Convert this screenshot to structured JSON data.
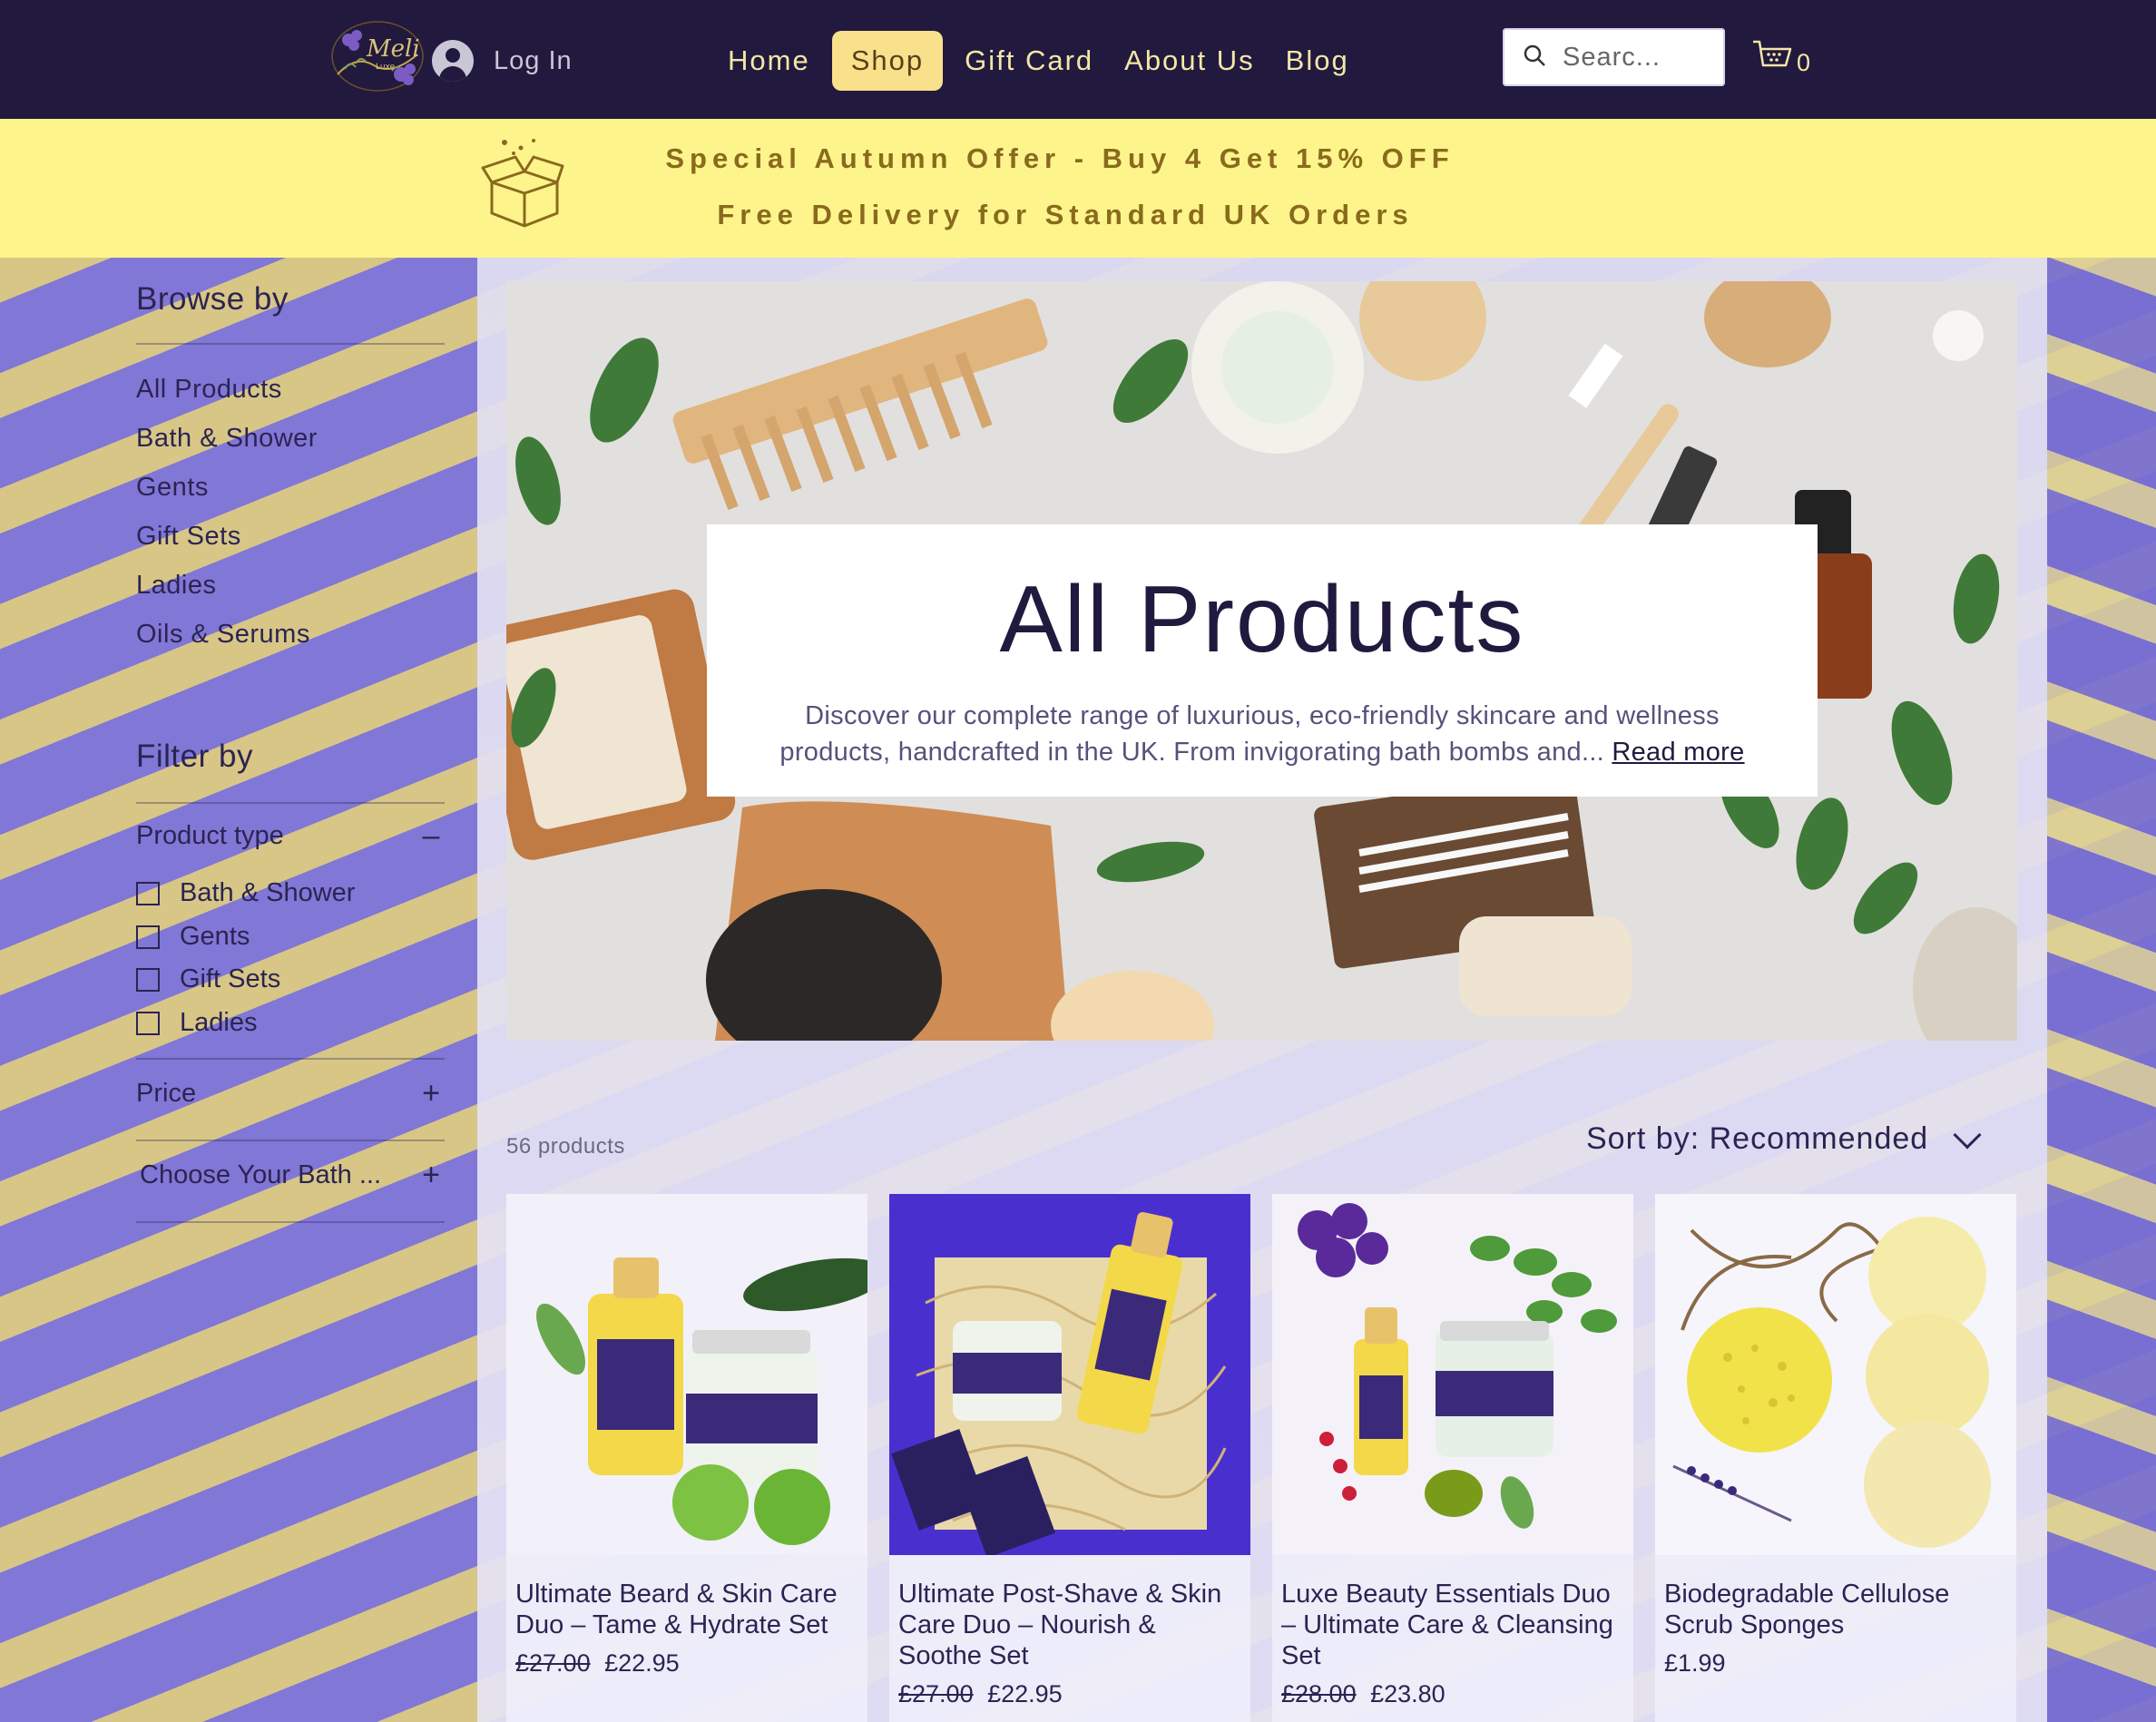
{
  "header": {
    "login_label": "Log In",
    "nav": [
      "Home",
      "Shop",
      "Gift Card",
      "About Us",
      "Blog"
    ],
    "active_nav": "Shop",
    "search_placeholder": "Searc...",
    "cart_count": "0"
  },
  "promo": {
    "line1": "Special Autumn Offer - Buy 4 Get 15% OFF",
    "line2": "Free Delivery for Standard UK Orders"
  },
  "sidebar": {
    "browse_heading": "Browse by",
    "browse_items": [
      "All Products",
      "Bath & Shower",
      "Gents",
      "Gift Sets",
      "Ladies",
      "Oils & Serums"
    ],
    "filter_heading": "Filter by",
    "product_type_label": "Product type",
    "product_type_options": [
      "Bath & Shower",
      "Gents",
      "Gift Sets",
      "Ladies"
    ],
    "price_label": "Price",
    "bath_label": "Choose Your Bath ..."
  },
  "hero": {
    "title": "All Products",
    "description": "Discover our complete range of luxurious, eco-friendly skincare and wellness products, handcrafted in the UK. From invigorating bath bombs and...",
    "read_more": "Read more"
  },
  "listing": {
    "count": "56 products",
    "sort_label": "Sort by: Recommended"
  },
  "products": [
    {
      "name": "Ultimate Beard & Skin Care Duo – Tame & Hydrate Set",
      "old_price": "£27.00",
      "price": "£22.95"
    },
    {
      "name": "Ultimate Post-Shave & Skin Care Duo – Nourish & Soothe Set",
      "old_price": "£27.00",
      "price": "£22.95"
    },
    {
      "name": "Luxe Beauty Essentials Duo – Ultimate Care & Cleansing Set",
      "old_price": "£28.00",
      "price": "£23.80"
    },
    {
      "name": "Biodegradable Cellulose Scrub Sponges",
      "old_price": "",
      "price": "£1.99"
    }
  ],
  "colors": {
    "header_bg": "#22193f",
    "nav_text": "#f4e7a6",
    "nav_active_bg": "#f9e08a",
    "promo_bg": "#fdf58c",
    "promo_text": "#8a6a1c",
    "text_dark": "#2b2452"
  },
  "icons": {
    "logo": "lavender-flower-logo",
    "login": "avatar-icon",
    "search": "search-icon",
    "cart": "basket-icon",
    "promo": "gift-box-icon",
    "collapse": "minus-icon",
    "expand": "plus-icon",
    "sort": "chevron-down-icon"
  }
}
